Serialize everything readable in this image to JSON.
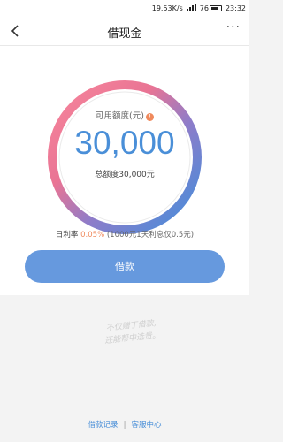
{
  "status_bar": {
    "network_speed": "19.53K/s",
    "battery_level": "76",
    "time": "23:32"
  },
  "nav": {
    "title": "借现金",
    "more_label": "···"
  },
  "credit": {
    "available_label": "可用额度(元)",
    "info_icon_glyph": "!",
    "available_amount": "30,000",
    "total_label": "总额度30,000元"
  },
  "rate": {
    "label": "日利率",
    "value": "0.05%",
    "note": "(1000元1天利息仅0.5元)"
  },
  "borrow_button_label": "借款",
  "slogan": {
    "line1": "不仅赠丁借款,",
    "line2": "还能帮中选贵。"
  },
  "links": {
    "records": "借款记录",
    "separator": "|",
    "service": "客服中心"
  },
  "colors": {
    "accent": "#6699de",
    "amount": "#4a8fd8",
    "rate_highlight": "#f08a5d",
    "gauge_gradient": [
      "#f7869c",
      "#ee6e8d",
      "#8e7cc9",
      "#4e95de",
      "#3f8fdc"
    ]
  },
  "icons": {
    "back": "back-chevron-icon",
    "more": "more-dots-icon",
    "info": "info-icon",
    "signal": "signal-icon",
    "battery": "battery-icon"
  }
}
